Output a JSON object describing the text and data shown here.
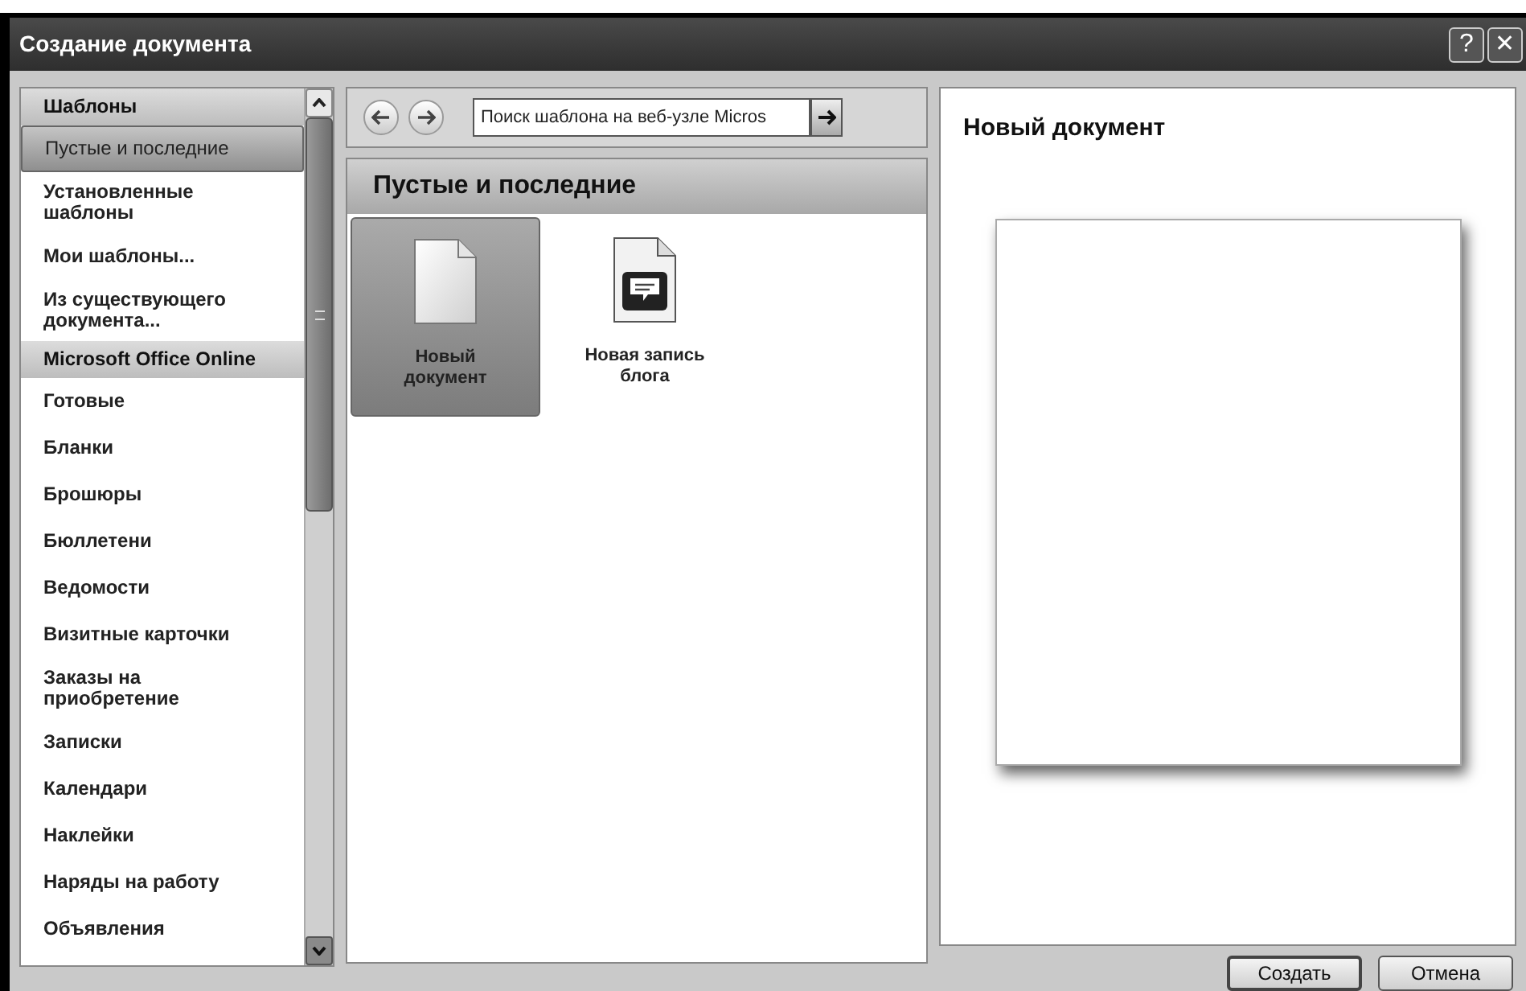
{
  "window": {
    "title": "Создание документа",
    "help": "?",
    "close": "✕"
  },
  "sidebar": {
    "items": [
      {
        "label": "Шаблоны",
        "kind": "header",
        "selected": false
      },
      {
        "label": "Пустые и последние",
        "kind": "item",
        "selected": true
      },
      {
        "label": "Установленные шаблоны",
        "kind": "item",
        "selected": false
      },
      {
        "label": "Мои шаблоны...",
        "kind": "item",
        "selected": false
      },
      {
        "label": "Из существующего документа...",
        "kind": "item",
        "selected": false
      },
      {
        "label": "Microsoft Office Online",
        "kind": "header",
        "selected": false
      },
      {
        "label": "Готовые",
        "kind": "item",
        "selected": false
      },
      {
        "label": "Бланки",
        "kind": "item",
        "selected": false
      },
      {
        "label": "Брошюры",
        "kind": "item",
        "selected": false
      },
      {
        "label": "Бюллетени",
        "kind": "item",
        "selected": false
      },
      {
        "label": "Ведомости",
        "kind": "item",
        "selected": false
      },
      {
        "label": "Визитные карточки",
        "kind": "item",
        "selected": false
      },
      {
        "label": "Заказы на приобретение",
        "kind": "item",
        "selected": false
      },
      {
        "label": "Записки",
        "kind": "item",
        "selected": false
      },
      {
        "label": "Календари",
        "kind": "item",
        "selected": false
      },
      {
        "label": "Наклейки",
        "kind": "item",
        "selected": false
      },
      {
        "label": "Наряды на работу",
        "kind": "item",
        "selected": false
      },
      {
        "label": "Объявления",
        "kind": "item",
        "selected": false
      }
    ]
  },
  "search": {
    "placeholder": "Поиск шаблона на веб-узле Micros"
  },
  "gallery": {
    "title": "Пустые и последние",
    "items": [
      {
        "label": "Новый документ",
        "kind": "blank",
        "selected": true
      },
      {
        "label": "Новая запись блога",
        "kind": "blog",
        "selected": false
      }
    ]
  },
  "preview": {
    "title": "Новый документ"
  },
  "buttons": [
    "Создать",
    "Отмена"
  ]
}
